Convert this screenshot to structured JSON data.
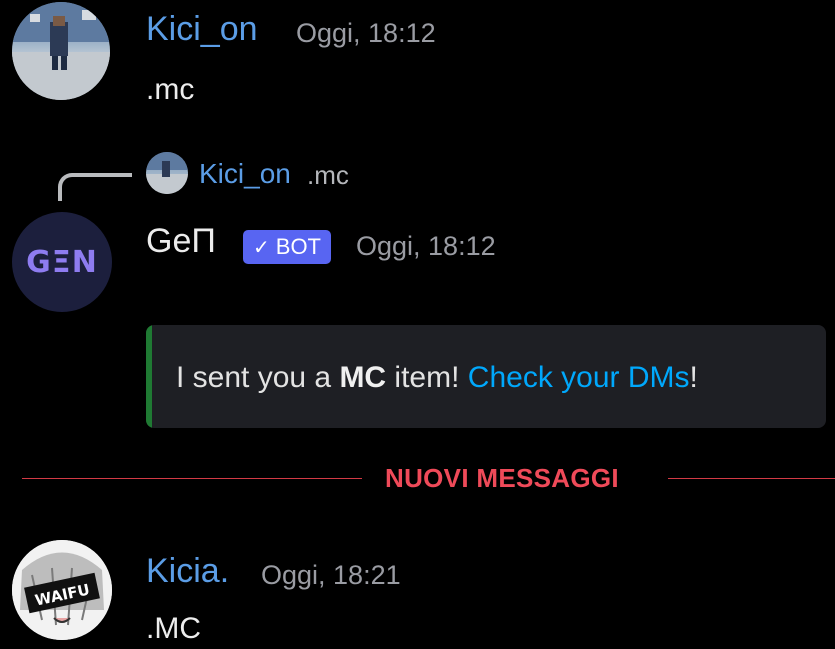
{
  "messages": [
    {
      "author": "Kici_on",
      "timestamp": "Oggi, 18:12",
      "text": ".mc"
    },
    {
      "reply": {
        "author": "Kici_on",
        "text": ".mc"
      },
      "author": "GeΠ",
      "badge": "BOT",
      "badge_check": "✓",
      "timestamp": "Oggi, 18:12",
      "avatar_text": "GΞN",
      "embed": {
        "text_before": "I sent you a ",
        "bold": "MC",
        "text_middle": " item! ",
        "link": "Check your DMs",
        "text_after": "!"
      }
    },
    {
      "author": "Kicia.",
      "timestamp": "Oggi, 18:21",
      "text": ".MC",
      "avatar_label": "WAIFU"
    }
  ],
  "divider": {
    "label": "NUOVI MESSAGGI"
  },
  "colors": {
    "username_blue": "#5b9de6",
    "link": "#00a8fc",
    "bot_badge": "#5865f2",
    "new_messages": "#ef4a59",
    "embed_bar": "#1f7a33"
  }
}
